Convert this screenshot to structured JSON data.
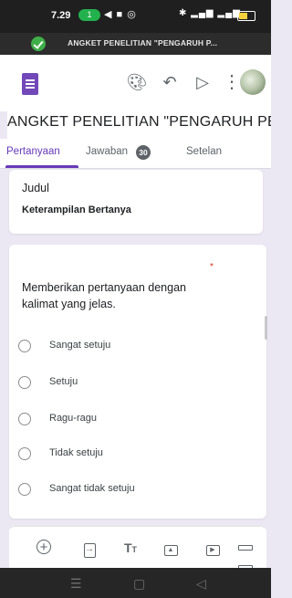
{
  "status_bar": {
    "time": "7.29",
    "notif_count": "1"
  },
  "browser": {
    "url_text": "ANGKET PENELITIAN \"PENGARUH P..."
  },
  "form": {
    "title": "ANGKET PENELITIAN \"PENGARUH PEN",
    "tabs": [
      {
        "label": "Pertanyaan",
        "active": true
      },
      {
        "label": "Jawaban",
        "badge": "30"
      },
      {
        "label": "Setelan"
      }
    ]
  },
  "section": {
    "label": "Judul",
    "title": "Keterampilan Bertanya"
  },
  "question": {
    "text": "Memberikan pertanyaan dengan kalimat yang jelas.",
    "required_marker": "*",
    "options": [
      "Sangat setuju",
      "Setuju",
      "Ragu-ragu",
      "Tidak setuju",
      "Sangat tidak setuju"
    ]
  },
  "toolbar_icons": [
    "palette-icon",
    "undo-icon",
    "send-icon",
    "more-vert-icon"
  ],
  "bottom_toolbar": {
    "title_text_icon": "TT"
  },
  "colors": {
    "accent": "#673ab7",
    "forms_icon": "#7248b9",
    "page_bg": "#ece8f3"
  }
}
